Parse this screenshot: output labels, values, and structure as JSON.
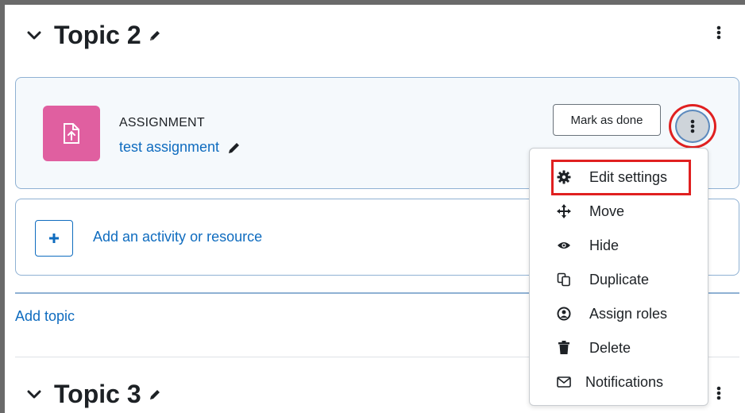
{
  "sections": [
    {
      "title": "Topic 2"
    },
    {
      "title": "Topic 3"
    }
  ],
  "activity": {
    "type_label": "ASSIGNMENT",
    "name": "test assignment",
    "mark_done_label": "Mark as done"
  },
  "add_activity": {
    "label": "Add an activity or resource"
  },
  "add_topic": {
    "label": "Add topic"
  },
  "actions_menu": {
    "items": [
      {
        "label": "Edit settings",
        "icon": "gear-icon"
      },
      {
        "label": "Move",
        "icon": "move-arrows-icon"
      },
      {
        "label": "Hide",
        "icon": "eye-icon"
      },
      {
        "label": "Duplicate",
        "icon": "duplicate-icon"
      },
      {
        "label": "Assign roles",
        "icon": "user-circle-icon"
      },
      {
        "label": "Delete",
        "icon": "trash-icon"
      },
      {
        "label": "Notifications",
        "icon": "envelope-icon"
      }
    ]
  },
  "colors": {
    "link": "#0f6cbf",
    "assignment_icon_bg": "#e05fa0",
    "highlight": "#e02020",
    "card_border": "#8fb1d3"
  }
}
